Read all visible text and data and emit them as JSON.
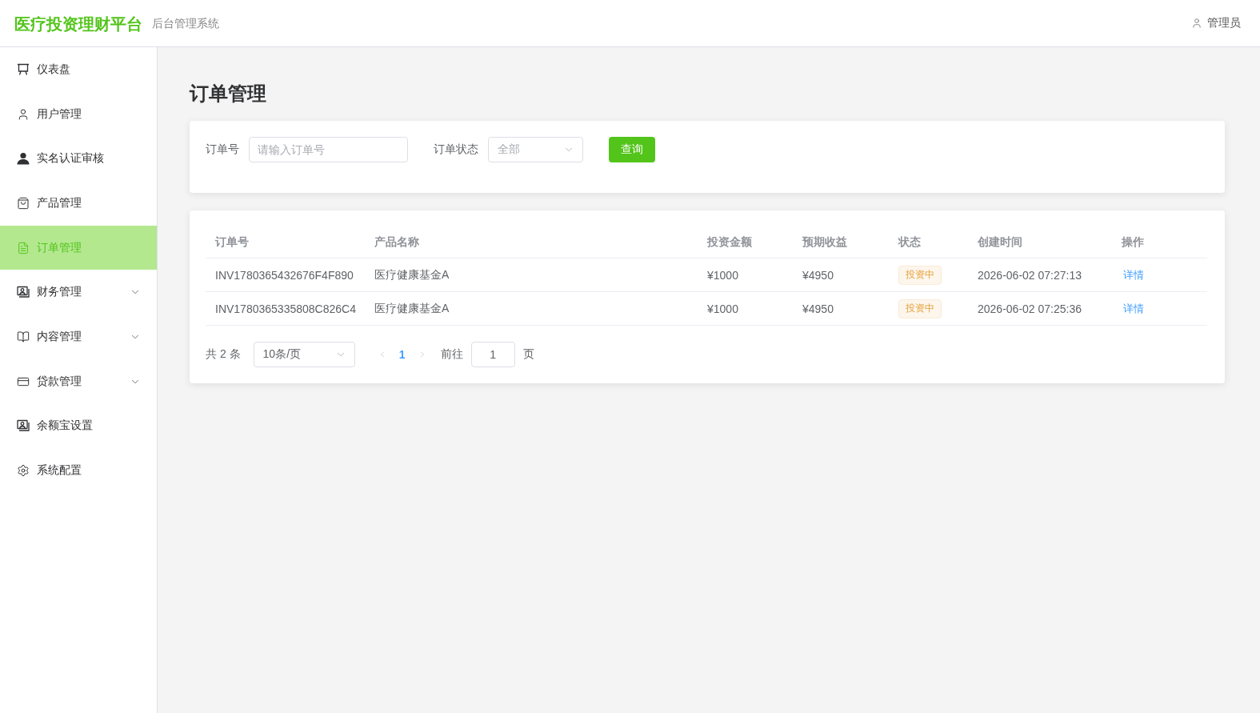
{
  "header": {
    "title": "医疗投资理财平台",
    "subtitle": "后台管理系统",
    "user": "管理员"
  },
  "sidebar": {
    "items": [
      {
        "label": "仪表盘",
        "kind": "link",
        "selected": false
      },
      {
        "label": "用户管理",
        "kind": "link",
        "selected": false
      },
      {
        "label": "实名认证审核",
        "kind": "link",
        "selected": false
      },
      {
        "label": "产品管理",
        "kind": "link",
        "selected": false
      },
      {
        "label": "订单管理",
        "kind": "link",
        "selected": true
      },
      {
        "label": "财务管理",
        "kind": "submenu",
        "selected": false
      },
      {
        "label": "内容管理",
        "kind": "submenu",
        "selected": false
      },
      {
        "label": "贷款管理",
        "kind": "submenu",
        "selected": false
      },
      {
        "label": "余额宝设置",
        "kind": "link",
        "selected": false
      },
      {
        "label": "系统配置",
        "kind": "link",
        "selected": false
      }
    ]
  },
  "page": {
    "title": "订单管理"
  },
  "filters": {
    "order_no": {
      "label": "订单号",
      "placeholder": "请输入订单号"
    },
    "status": {
      "label": "订单状态",
      "value": "全部"
    },
    "search_button": "查询"
  },
  "table": {
    "columns": [
      "订单号",
      "产品名称",
      "投资金额",
      "预期收益",
      "状态",
      "创建时间",
      "操作"
    ],
    "rows": [
      {
        "order_no": "INV1780365432676F4F890",
        "product": "医疗健康基金A",
        "amount": "¥1000",
        "expected_return": "¥4950",
        "status": {
          "label": "投资中",
          "kind": "warning"
        },
        "created_at": "2026-06-02 07:27:13",
        "action": "详情"
      },
      {
        "order_no": "INV1780365335808C826C4",
        "product": "医疗健康基金A",
        "amount": "¥1000",
        "expected_return": "¥4950",
        "status": {
          "label": "投资中",
          "kind": "warning"
        },
        "created_at": "2026-06-02 07:25:36",
        "action": "详情"
      }
    ]
  },
  "pagination": {
    "total": "共 2 条",
    "page_size": "10条/页",
    "prev_disabled": true,
    "next_disabled": true,
    "pages": [
      {
        "label": "1",
        "selected": true
      }
    ],
    "goto_label": "前往",
    "goto_value": "1",
    "page_suffix": "页"
  }
}
